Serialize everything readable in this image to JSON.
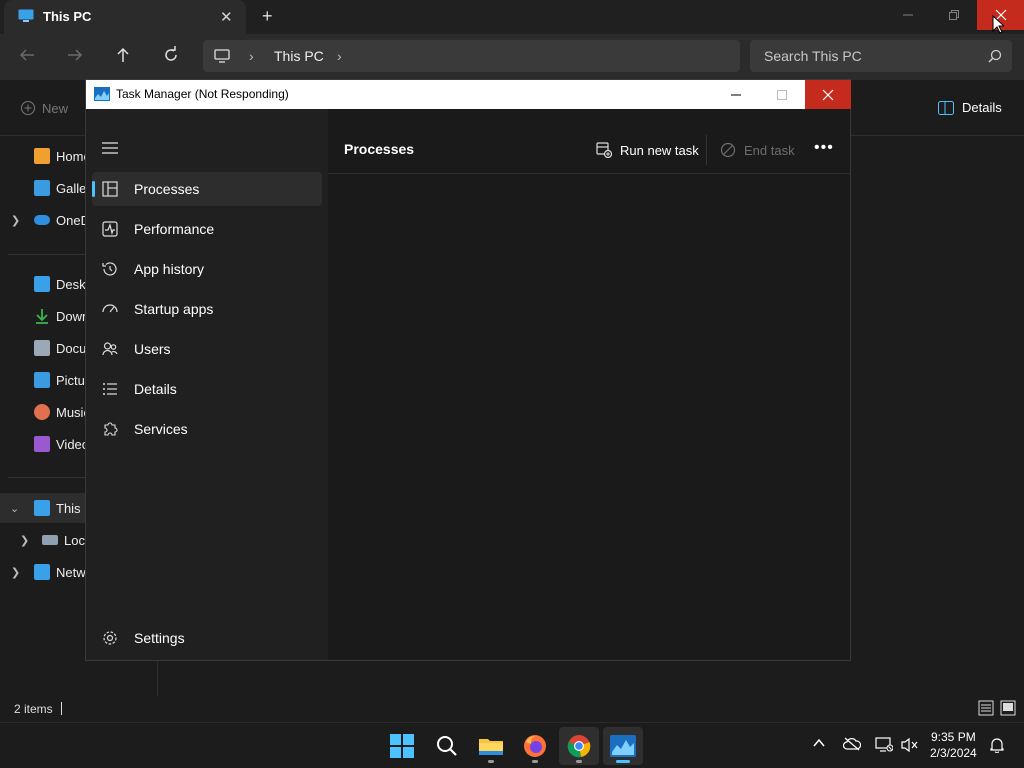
{
  "explorer": {
    "tab_title": "This PC",
    "tab_close": "✕",
    "new_tab": "+",
    "breadcrumb": [
      "This PC"
    ],
    "search_placeholder": "Search This PC",
    "new_label": "New",
    "details_label": "Details",
    "nav_items": [
      {
        "label": "Home",
        "icon": "home-icon",
        "color": "#f0a030"
      },
      {
        "label": "Gallery",
        "icon": "gallery-icon",
        "color": "#3a9be0"
      },
      {
        "label": "OneDrive",
        "icon": "cloud-icon",
        "color": "#2e8fe0"
      },
      {
        "label": "Desktop",
        "icon": "desktop-icon",
        "color": "#3aa0e8"
      },
      {
        "label": "Downloads",
        "icon": "download-icon",
        "color": "#39b54a"
      },
      {
        "label": "Documents",
        "icon": "document-icon",
        "color": "#9aa8b8"
      },
      {
        "label": "Pictures",
        "icon": "pictures-icon",
        "color": "#3a9be0"
      },
      {
        "label": "Music",
        "icon": "music-icon",
        "color": "#e07050"
      },
      {
        "label": "Videos",
        "icon": "video-icon",
        "color": "#9b59d0"
      },
      {
        "label": "This PC",
        "icon": "computer-icon",
        "color": "#3aa0e8"
      },
      {
        "label": "Local Disk",
        "icon": "drive-icon",
        "color": "#8fa0b0"
      },
      {
        "label": "Network",
        "icon": "network-icon",
        "color": "#3aa0e8"
      }
    ],
    "status_items": "2 items"
  },
  "task_manager": {
    "title": "Task Manager (Not Responding)",
    "nav": [
      {
        "label": "Processes",
        "selected": true
      },
      {
        "label": "Performance"
      },
      {
        "label": "App history"
      },
      {
        "label": "Startup apps"
      },
      {
        "label": "Users"
      },
      {
        "label": "Details"
      },
      {
        "label": "Services"
      }
    ],
    "settings_label": "Settings",
    "header": "Processes",
    "run_new_task": "Run new task",
    "end_task": "End task",
    "more": "•••"
  },
  "taskbar": {
    "time": "9:35 PM",
    "date": "2/3/2024",
    "apps": [
      "start-icon",
      "search-icon",
      "file-explorer-icon",
      "firefox-icon",
      "chrome-icon",
      "task-manager-icon"
    ]
  },
  "colors": {
    "accent": "#4cc2ff",
    "close_red": "#c42b1c",
    "dark_bg": "#1c1c1c"
  }
}
